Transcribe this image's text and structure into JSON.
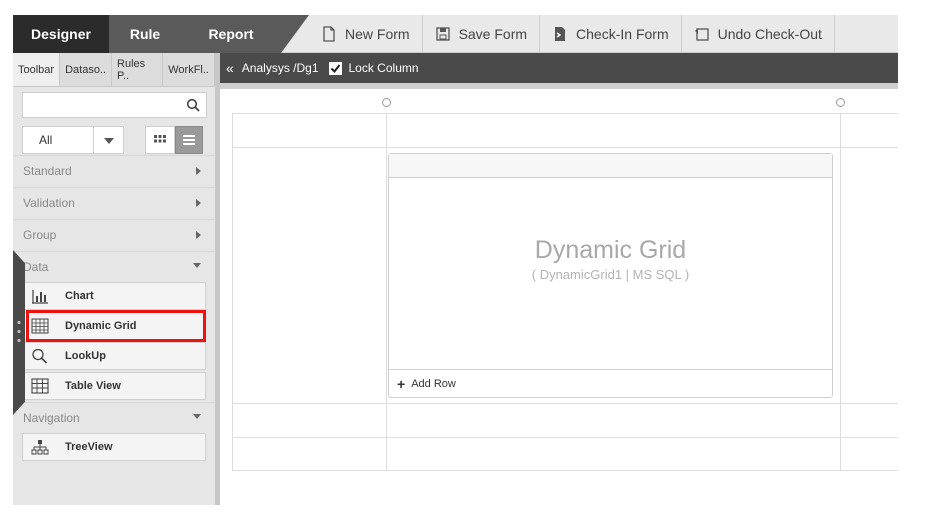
{
  "topbar": {
    "tabs": [
      "Designer",
      "Rule",
      "Report"
    ],
    "actions": [
      "New Form",
      "Save Form",
      "Check-In Form",
      "Undo Check-Out"
    ]
  },
  "left": {
    "tabs": [
      "Toolbar",
      "Dataso..",
      "Rules P..",
      "WorkFl.."
    ],
    "search_placeholder": "",
    "filter_value": "All",
    "sections": {
      "standard": "Standard",
      "validation": "Validation",
      "group": "Group",
      "data": "Data",
      "navigation": "Navigation"
    },
    "data_items": [
      "Chart",
      "Dynamic Grid",
      "LookUp",
      "Table View"
    ],
    "navigation_items": [
      "TreeView"
    ]
  },
  "pathbar": {
    "path": "Analysys /Dg1",
    "lock_label": "Lock Column"
  },
  "grid": {
    "title": "Dynamic Grid",
    "subtitle": "( DynamicGrid1 | MS SQL )",
    "add_row": "Add Row"
  },
  "colors": {
    "accent_highlight": "#e11111",
    "topbar_dark": "#2b2b2b",
    "pathbar": "#4a4a4a"
  }
}
